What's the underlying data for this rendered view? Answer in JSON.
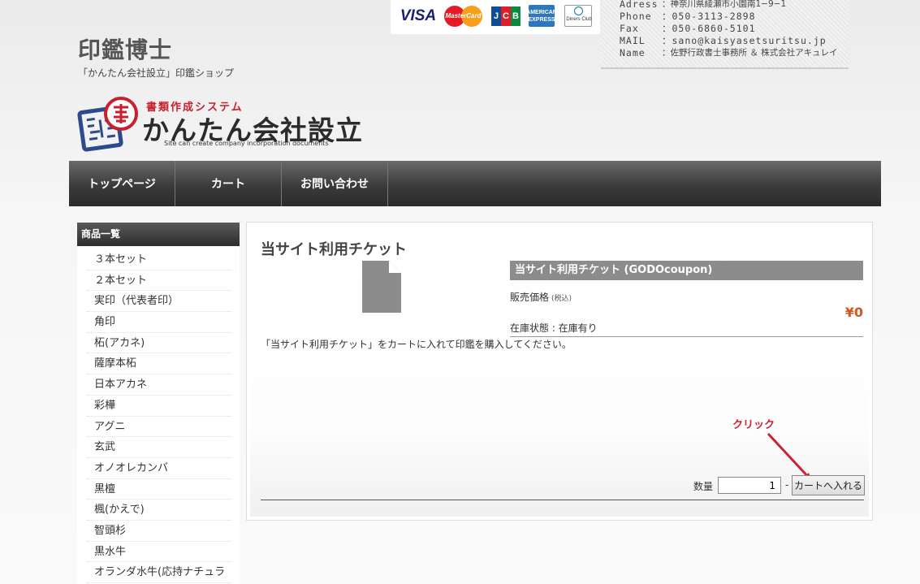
{
  "site": {
    "title": "印鑑博士",
    "tagline": "「かんたん会社設立」印鑑ショップ"
  },
  "payment_cards": [
    {
      "name": "VISA",
      "label": "VISA"
    },
    {
      "name": "MasterCard",
      "label": "MasterCard"
    },
    {
      "name": "JCB",
      "label": "JCB"
    },
    {
      "name": "American Express",
      "label": "AMERICAN EXPRESS"
    },
    {
      "name": "Diners Club",
      "label": "Diners Club"
    }
  ],
  "contact": {
    "address_label": "Adress",
    "address": "：神奈川県綾瀬市小園南1−9−1",
    "phone_label": "Phone",
    "phone": "：050-3113-2898",
    "fax_label": "Fax",
    "fax": "：050-6860-5101",
    "mail_label": "MAIL",
    "mail": "：sano@kaisyasetsuritsu.jp",
    "name_label": "Name",
    "name": "：佐野行政書士事務所 ＆ 株式会社アキュレイ"
  },
  "logo": {
    "sub": "書類作成システム",
    "main": "かんたん会社設立",
    "english": "Site can create company incorporation documents",
    "stamp_colors": {
      "blue": "#2d4a8c",
      "red": "#c8202d"
    }
  },
  "nav": {
    "items": [
      "トップページ",
      "カート",
      "お問い合わせ"
    ]
  },
  "sidebar": {
    "heading": "商品一覧",
    "items": [
      "３本セット",
      "２本セット",
      "実印（代表者印）",
      "角印",
      "柘(アカネ)",
      "薩摩本柘",
      "日本アカネ",
      "彩樺",
      "アグニ",
      "玄武",
      "オノオレカンバ",
      "黒檀",
      "楓(かえで)",
      "智頭杉",
      "黒水牛",
      "オランダ水牛(応持ナチュラ"
    ]
  },
  "product": {
    "title": "当サイト利用チケット",
    "detail_heading": "当サイト利用チケット (GODOcoupon)",
    "price_label": "販売価格",
    "price_tax_note": "(税込)",
    "price": "¥0",
    "stock": "在庫状態 : 在庫有り",
    "description": "「当サイト利用チケット」をカートに入れて印鑑を購入してください。",
    "image_icon": "document-icon"
  },
  "purchase": {
    "quantity_label": "数量",
    "quantity": "1",
    "separator": "-",
    "add_to_cart": "カートへ入れる"
  },
  "annotation": {
    "text": "クリック",
    "color": "#cc2233"
  },
  "colors": {
    "accent_price": "#d4541c",
    "nav_dark": "#2a2a2a"
  }
}
